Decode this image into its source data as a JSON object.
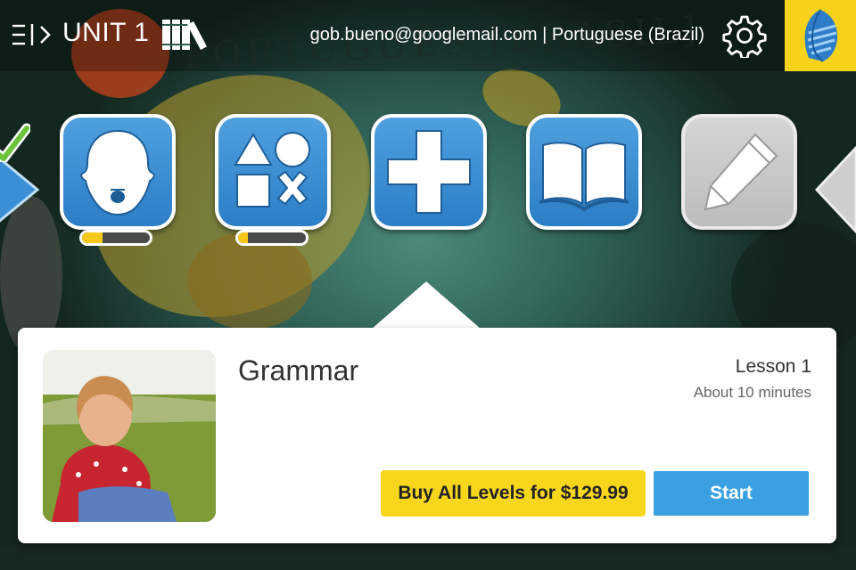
{
  "header": {
    "unit_title": "UNIT 1",
    "account_text": "gob.bueno@googlemail.com | Portuguese (Brazil)",
    "background_title": "PORTUGUÊS [BRASIL]"
  },
  "icons": {
    "menu": "menu-toggle-icon",
    "library": "library-books-icon",
    "settings": "gear-icon",
    "brand": "rosetta-stone-logo"
  },
  "carousel": {
    "tiles": [
      {
        "name": "pronunciation",
        "icon": "speaking-head-icon",
        "progress": 0.3,
        "state": "active"
      },
      {
        "name": "vocabulary",
        "icon": "shapes-icon",
        "progress": 0.15,
        "state": "active"
      },
      {
        "name": "grammar",
        "icon": "plus-icon",
        "state": "selected"
      },
      {
        "name": "reading",
        "icon": "open-book-icon",
        "state": "active"
      },
      {
        "name": "writing",
        "icon": "pencil-icon",
        "state": "locked"
      }
    ]
  },
  "card": {
    "title": "Grammar",
    "lesson": "Lesson 1",
    "duration": "About 10 minutes",
    "buy_label": "Buy All Levels for $129.99",
    "start_label": "Start"
  },
  "colors": {
    "accent_blue": "#3aa0e2",
    "tile_blue": "#2c7ec6",
    "brand_yellow": "#f6d21b",
    "progress_yellow": "#f6c81b",
    "check_green": "#6cc33a"
  }
}
